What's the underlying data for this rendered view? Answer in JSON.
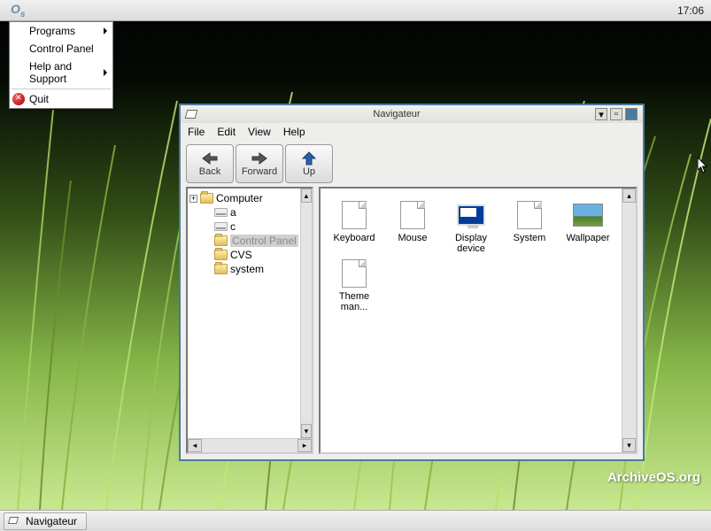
{
  "panel": {
    "logo": "O",
    "logo_sub": "s",
    "clock": "17:06"
  },
  "start_menu": {
    "programs": "Programs",
    "control_panel": "Control Panel",
    "help": "Help and Support",
    "quit": "Quit"
  },
  "window": {
    "title": "Navigateur",
    "menu": {
      "file": "File",
      "edit": "Edit",
      "view": "View",
      "help": "Help"
    },
    "toolbar": {
      "back": "Back",
      "forward": "Forward",
      "up": "Up"
    },
    "tree": {
      "root": "Computer",
      "items": [
        "a",
        "c",
        "Control Panel",
        "CVS",
        "system"
      ]
    },
    "icons": [
      "Keyboard",
      "Mouse",
      "Display device",
      "System",
      "Wallpaper",
      "Theme man..."
    ]
  },
  "taskbar": {
    "app": "Navigateur"
  },
  "watermark": "ArchiveOS.org"
}
